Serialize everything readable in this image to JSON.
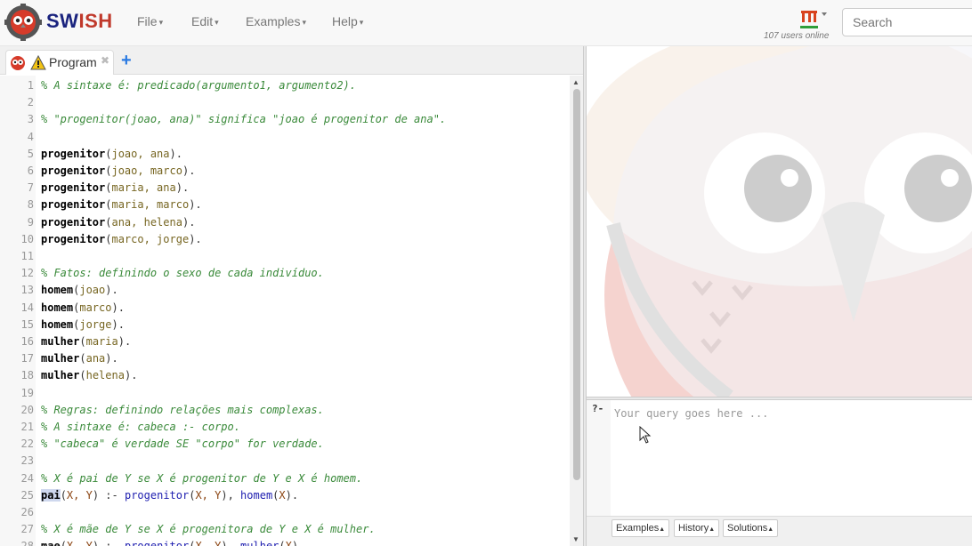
{
  "app": {
    "brand_prefix": "SW",
    "brand_suffix": "ISH",
    "menu": [
      "File",
      "Edit",
      "Examples",
      "Help"
    ],
    "users_online": "107 users online",
    "search_placeholder": "Search"
  },
  "tab": {
    "label": "Program",
    "close": "✖",
    "add": "+"
  },
  "editor": {
    "lines": [
      {
        "n": "1",
        "kind": "comment",
        "text": "% A sintaxe é: predicado(argumento1, argumento2)."
      },
      {
        "n": "2",
        "kind": "blank",
        "text": ""
      },
      {
        "n": "3",
        "kind": "comment",
        "text": "% \"progenitor(joao, ana)\" significa \"joao é progenitor de ana\"."
      },
      {
        "n": "4",
        "kind": "blank",
        "text": ""
      },
      {
        "n": "5",
        "kind": "fact",
        "pred": "progenitor",
        "args": "joao, ana",
        "tail": "."
      },
      {
        "n": "6",
        "kind": "fact",
        "pred": "progenitor",
        "args": "joao, marco",
        "tail": "."
      },
      {
        "n": "7",
        "kind": "fact",
        "pred": "progenitor",
        "args": "maria, ana",
        "tail": "."
      },
      {
        "n": "8",
        "kind": "fact",
        "pred": "progenitor",
        "args": "maria, marco",
        "tail": "."
      },
      {
        "n": "9",
        "kind": "fact",
        "pred": "progenitor",
        "args": "ana, helena",
        "tail": "."
      },
      {
        "n": "10",
        "kind": "fact",
        "pred": "progenitor",
        "args": "marco, jorge",
        "tail": "."
      },
      {
        "n": "11",
        "kind": "blank",
        "text": ""
      },
      {
        "n": "12",
        "kind": "comment",
        "text": "% Fatos: definindo o sexo de cada indivíduo."
      },
      {
        "n": "13",
        "kind": "fact",
        "pred": "homem",
        "args": "joao",
        "tail": "."
      },
      {
        "n": "14",
        "kind": "fact",
        "pred": "homem",
        "args": "marco",
        "tail": "."
      },
      {
        "n": "15",
        "kind": "fact",
        "pred": "homem",
        "args": "jorge",
        "tail": "."
      },
      {
        "n": "16",
        "kind": "fact",
        "pred": "mulher",
        "args": "maria",
        "tail": "."
      },
      {
        "n": "17",
        "kind": "fact",
        "pred": "mulher",
        "args": "ana",
        "tail": "."
      },
      {
        "n": "18",
        "kind": "fact",
        "pred": "mulher",
        "args": "helena",
        "tail": "."
      },
      {
        "n": "19",
        "kind": "blank",
        "text": ""
      },
      {
        "n": "20",
        "kind": "comment",
        "text": "% Regras: definindo relações mais complexas."
      },
      {
        "n": "21",
        "kind": "comment",
        "text": "% A sintaxe é: cabeca :- corpo."
      },
      {
        "n": "22",
        "kind": "comment",
        "text": "% \"cabeca\" é verdade SE \"corpo\" for verdade."
      },
      {
        "n": "23",
        "kind": "blank",
        "text": ""
      },
      {
        "n": "24",
        "kind": "comment",
        "text": "% X é pai de Y se X é progenitor de Y e X é homem."
      },
      {
        "n": "25",
        "kind": "rule",
        "head": "pai",
        "hargs": "X, Y",
        "neck": " :- ",
        "g1": "progenitor",
        "g1args": "X, Y",
        "sep": ", ",
        "g2": "homem",
        "g2args": "X",
        "tail": "."
      },
      {
        "n": "26",
        "kind": "blank",
        "text": ""
      },
      {
        "n": "27",
        "kind": "comment",
        "text": "% X é mãe de Y se X é progenitora de Y e X é mulher."
      },
      {
        "n": "28",
        "kind": "rule",
        "head": "mae",
        "hargs": "X, Y",
        "neck": " :- ",
        "g1": "progenitor",
        "g1args": "X, Y",
        "sep": ", ",
        "g2": "mulher",
        "g2args": "X",
        "tail": "."
      }
    ]
  },
  "query": {
    "prompt": "?-",
    "placeholder": "Your query goes here ...",
    "buttons": [
      "Examples",
      "History",
      "Solutions"
    ]
  },
  "colors": {
    "brand_dark": "#1a237e",
    "brand_red": "#c0392b",
    "comment": "#3a8a3a",
    "goal": "#2020b0"
  }
}
